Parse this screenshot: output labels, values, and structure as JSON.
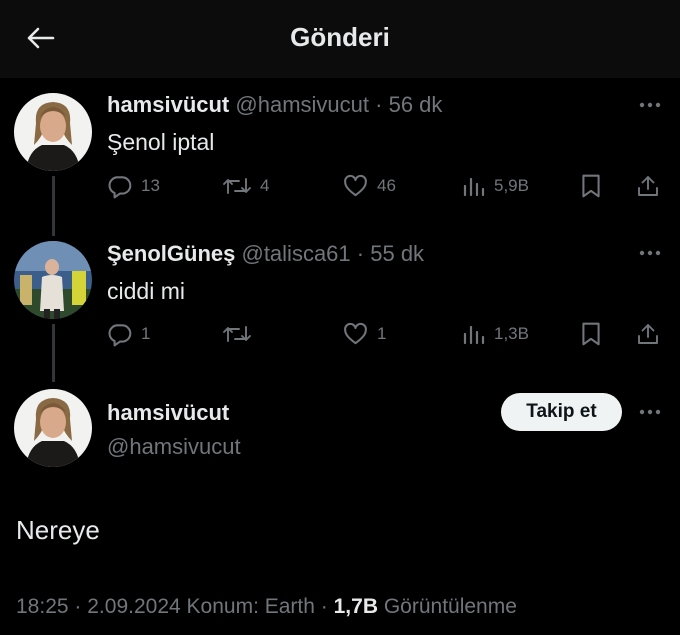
{
  "header": {
    "title": "Gönderi"
  },
  "tweets": [
    {
      "name": "hamsivücut",
      "handle": "@hamsivucut",
      "separator": "·",
      "time": "56 dk",
      "text": "Şenol iptal",
      "replies": "13",
      "retweets": "4",
      "likes": "46",
      "views": "5,9B"
    },
    {
      "name": "ŞenolGüneş",
      "handle": "@talisca61",
      "separator": "·",
      "time": "55 dk",
      "text": "ciddi mi",
      "replies": "1",
      "retweets": "",
      "likes": "1",
      "views": "1,3B"
    }
  ],
  "main_tweet": {
    "name": "hamsivücut",
    "handle": "@hamsivucut",
    "follow_label": "Takip et",
    "text": "Nereye",
    "time": "18:25",
    "date": "2.09.2024",
    "location": "Konum: Earth",
    "separator": "·",
    "views_count": "1,7B",
    "views_label": "Görüntülenme"
  },
  "colors": {
    "background": "#000000",
    "header_bg": "#0c0c0c",
    "primary_text": "#e7e9ea",
    "secondary_text": "#71767b",
    "follow_button_bg": "#eff3f4"
  },
  "icons": [
    "back-arrow-icon",
    "reply-icon",
    "retweet-icon",
    "like-icon",
    "views-icon",
    "bookmark-icon",
    "share-icon",
    "more-icon"
  ]
}
